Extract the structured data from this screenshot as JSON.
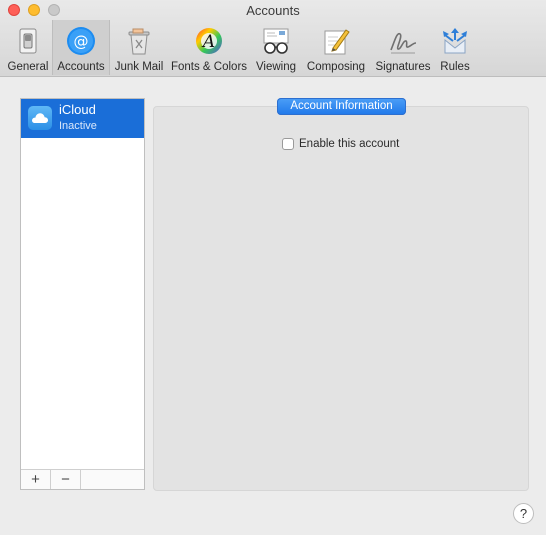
{
  "window": {
    "title": "Accounts"
  },
  "toolbar": {
    "tabs": [
      {
        "label": "General",
        "icon": "switch-icon",
        "selected": false
      },
      {
        "label": "Accounts",
        "icon": "at-icon",
        "selected": true
      },
      {
        "label": "Junk Mail",
        "icon": "trash-icon",
        "selected": false
      },
      {
        "label": "Fonts & Colors",
        "icon": "color-wheel-icon",
        "selected": false
      },
      {
        "label": "Viewing",
        "icon": "glasses-icon",
        "selected": false
      },
      {
        "label": "Composing",
        "icon": "pencil-icon",
        "selected": false
      },
      {
        "label": "Signatures",
        "icon": "signature-icon",
        "selected": false
      },
      {
        "label": "Rules",
        "icon": "rules-icon",
        "selected": false
      }
    ]
  },
  "accounts": {
    "items": [
      {
        "name": "iCloud",
        "status": "Inactive",
        "icon": "cloud-icon"
      }
    ],
    "add_label": "+",
    "remove_label": "−"
  },
  "detail": {
    "section_title": "Account Information",
    "enable_label": "Enable this account",
    "enabled": false
  },
  "help": {
    "label": "?"
  },
  "colors": {
    "selection": "#1a6ed8",
    "accent": "#2d84ef"
  }
}
